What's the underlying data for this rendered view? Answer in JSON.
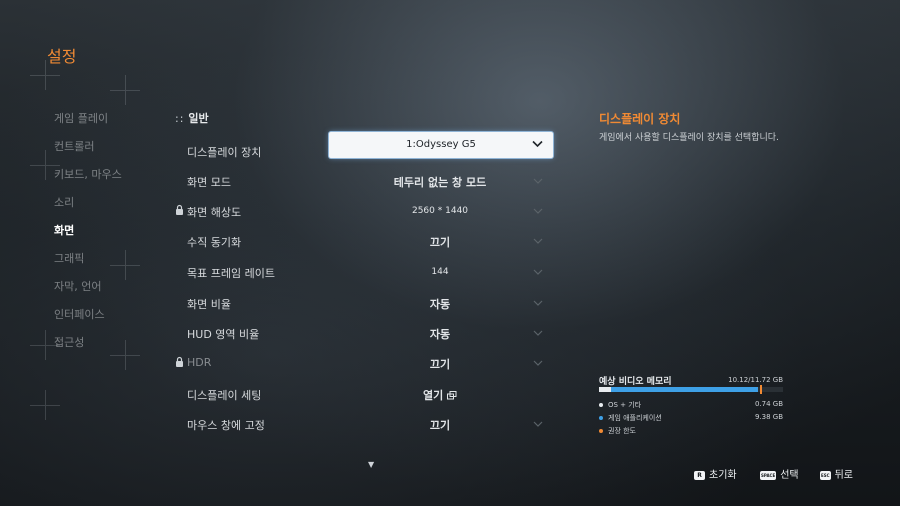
{
  "title": "설정",
  "nav": {
    "subtitle": "Ξ",
    "items": [
      {
        "label": "게임 플레이",
        "active": false
      },
      {
        "label": "컨트롤러",
        "active": false
      },
      {
        "label": "키보드, 마우스",
        "active": false
      },
      {
        "label": "소리",
        "active": false
      },
      {
        "label": "화면",
        "active": true
      },
      {
        "label": "그래픽",
        "active": false
      },
      {
        "label": "자막, 언어",
        "active": false
      },
      {
        "label": "인터페이스",
        "active": false
      },
      {
        "label": "접근성",
        "active": false
      }
    ]
  },
  "section": {
    "dots": "::",
    "title": "일반"
  },
  "settings": [
    {
      "label": "디스플레이 장치",
      "value": "1:Odyssey G5",
      "locked": false,
      "selected": true
    },
    {
      "label": "화면 모드",
      "value": "테두리 없는 창 모드",
      "locked": false
    },
    {
      "label": "화면 해상도",
      "value": "2560 * 1440",
      "locked": true
    },
    {
      "label": "수직 동기화",
      "value": "끄기",
      "locked": false
    },
    {
      "label": "목표 프레임 레이트",
      "value": "144",
      "locked": false
    },
    {
      "label": "화면 비율",
      "value": "자동",
      "locked": false
    },
    {
      "label": "HUD 영역 비율",
      "value": "자동",
      "locked": false
    },
    {
      "label": "HDR",
      "value": "끄기",
      "locked": true
    },
    {
      "label": "디스플레이 세팅",
      "value": "열기",
      "locked": false,
      "external": true
    },
    {
      "label": "마우스 창에 고정",
      "value": "끄기",
      "locked": false
    }
  ],
  "description": {
    "title": "디스플레이 장치",
    "text": "게임에서 사용할 디스플레이 장치를 선택합니다."
  },
  "memory": {
    "title": "예상 비디오 메모리",
    "total": "10.12/11.72 GB",
    "used_fraction": 0.863,
    "os_fraction": 0.063,
    "app_fraction": 0.8,
    "rows": [
      {
        "label": "OS + 기타",
        "amount": "0.74 GB",
        "color": "#e8ecef"
      },
      {
        "label": "게임 애플리케이션",
        "amount": "9.38 GB",
        "color": "#3ea0e6"
      },
      {
        "label": "권장 한도",
        "amount": "",
        "color": "#f08a34"
      }
    ]
  },
  "footer": {
    "reset": {
      "key": "R",
      "label": "초기화"
    },
    "select": {
      "key": "SPACE",
      "label": "선택"
    },
    "back": {
      "key": "ESC",
      "label": "뒤로"
    }
  },
  "colors": {
    "accent": "#f08a34",
    "memory_app": "#3ea0e6"
  }
}
